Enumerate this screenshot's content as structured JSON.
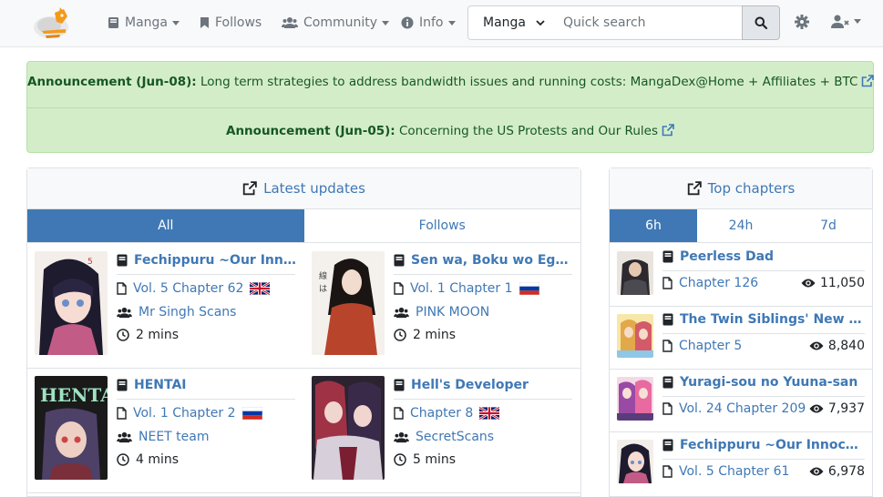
{
  "nav": {
    "manga_label": "Manga",
    "follows_label": "Follows",
    "community_label": "Community",
    "info_label": "Info",
    "search_type": "Manga",
    "search_placeholder": "Quick search"
  },
  "announcements": [
    {
      "label": "Announcement (Jun-08):",
      "text": "Long term strategies to address bandwidth issues and running costs: MangaDex@Home + Affiliates + BTC"
    },
    {
      "label": "Announcement (Jun-05):",
      "text": "Concerning the US Protests and Our Rules"
    }
  ],
  "latest": {
    "header": "Latest updates",
    "tabs": [
      "All",
      "Follows"
    ],
    "items": [
      {
        "title": "Fechippuru ~Our Innocent Love~",
        "chapter": "Vol. 5 Chapter 62",
        "flag": "gb",
        "group": "Mr Singh Scans",
        "time": "2 mins"
      },
      {
        "title": "Sen wa, Boku wo Egaku",
        "chapter": "Vol. 1 Chapter 1",
        "flag": "ru",
        "group": "PINK MOON",
        "time": "2 mins"
      },
      {
        "title": "HENTAI",
        "chapter": "Vol. 1 Chapter 2",
        "flag": "ru",
        "group": "NEET team",
        "time": "4 mins"
      },
      {
        "title": "Hell's Developer",
        "chapter": "Chapter 8",
        "flag": "gb",
        "group": "SecretScans",
        "time": "5 mins"
      }
    ]
  },
  "top": {
    "header": "Top chapters",
    "tabs": [
      "6h",
      "24h",
      "7d"
    ],
    "items": [
      {
        "title": "Peerless Dad",
        "chapter": "Chapter 126",
        "views": "11,050"
      },
      {
        "title": "The Twin Siblings' New Life",
        "chapter": "Chapter 5",
        "views": "8,840"
      },
      {
        "title": "Yuragi-sou no Yuuna-san",
        "chapter": "Vol. 24 Chapter 209",
        "views": "7,937"
      },
      {
        "title": "Fechippuru ~Our Innocent Love~",
        "chapter": "Vol. 5 Chapter 61",
        "views": "6,978"
      }
    ]
  },
  "colors": {
    "accent": "#3f78b5",
    "announce_bg": "#d4edc9",
    "announce_text": "#155724"
  },
  "icons": {
    "book": "book-icon",
    "bookmark": "bookmark-icon",
    "users": "users-icon",
    "info": "info-icon",
    "search": "search-icon",
    "gear": "gear-icon",
    "user": "user-icon",
    "external": "external-link-icon",
    "file": "file-icon",
    "clock": "clock-icon",
    "eye": "eye-icon"
  }
}
